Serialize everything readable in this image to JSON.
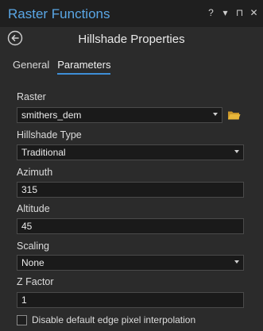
{
  "window": {
    "title": "Raster Functions",
    "controls": [
      "?",
      "▾",
      "⊓",
      "✕"
    ]
  },
  "header": {
    "page_title": "Hillshade Properties"
  },
  "tabs": [
    {
      "label": "General",
      "active": false
    },
    {
      "label": "Parameters",
      "active": true
    }
  ],
  "form": {
    "raster": {
      "label": "Raster",
      "value": "smithers_dem"
    },
    "hillshade_type": {
      "label": "Hillshade Type",
      "value": "Traditional"
    },
    "azimuth": {
      "label": "Azimuth",
      "value": "315"
    },
    "altitude": {
      "label": "Altitude",
      "value": "45"
    },
    "scaling": {
      "label": "Scaling",
      "value": "None"
    },
    "z_factor": {
      "label": "Z Factor",
      "value": "1"
    },
    "edge_interpolation": {
      "label": "Disable default edge pixel interpolation",
      "checked": false
    }
  },
  "colors": {
    "accent": "#3e8fd8",
    "title": "#5aa7e6",
    "folder": "#e8b73a"
  }
}
